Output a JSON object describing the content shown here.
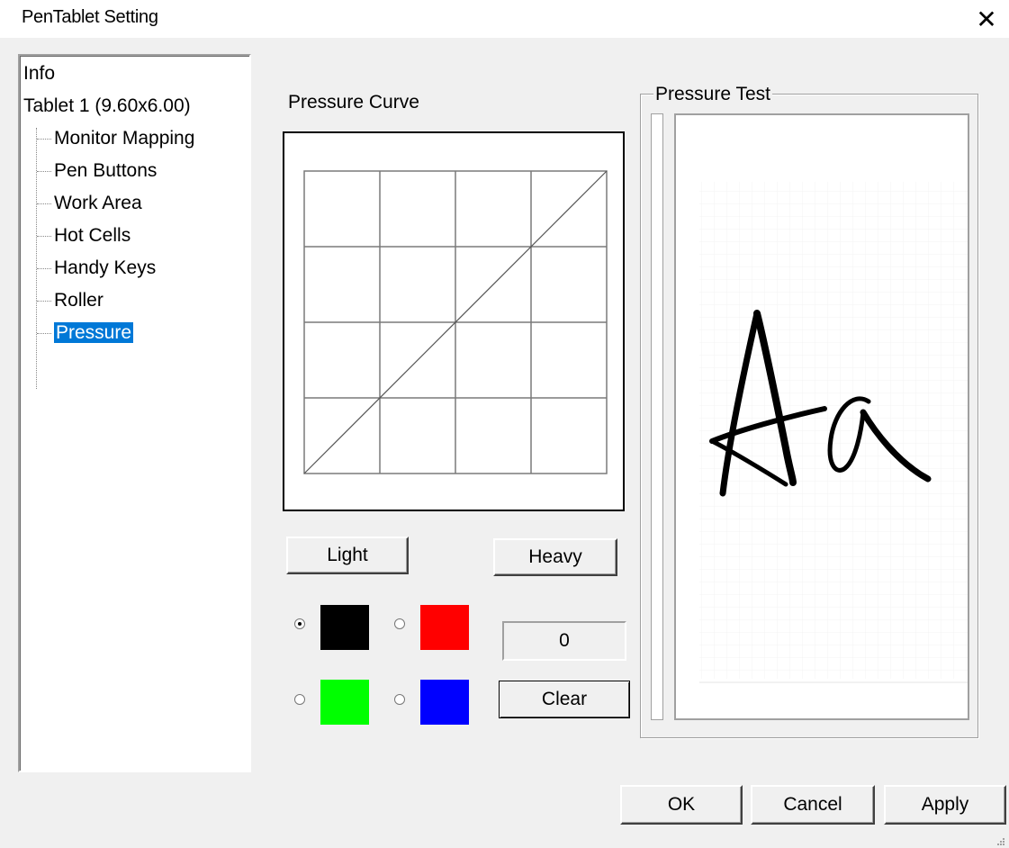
{
  "window": {
    "title": "PenTablet Setting",
    "close_symbol": "✕"
  },
  "tree": {
    "items": [
      {
        "label": "Info"
      },
      {
        "label": "Tablet  1 (9.60x6.00)"
      }
    ],
    "children": [
      {
        "label": "Monitor Mapping"
      },
      {
        "label": "Pen Buttons"
      },
      {
        "label": "Work Area"
      },
      {
        "label": "Hot Cells"
      },
      {
        "label": "Handy Keys"
      },
      {
        "label": "Roller"
      },
      {
        "label": "Pressure",
        "selected": true
      }
    ]
  },
  "pressure_curve": {
    "label": "Pressure Curve",
    "grid_divisions": 4,
    "curve": "linear",
    "light_label": "Light",
    "heavy_label": "Heavy"
  },
  "colors": {
    "options": [
      {
        "color": "#000000",
        "selected": true
      },
      {
        "color": "#ff0000",
        "selected": false
      },
      {
        "color": "#00ff00",
        "selected": false
      },
      {
        "color": "#0000ff",
        "selected": false
      }
    ]
  },
  "pressure_value": "0",
  "clear_label": "Clear",
  "pressure_test": {
    "label": "Pressure Test",
    "sample_text": "Aa"
  },
  "footer": {
    "ok_label": "OK",
    "cancel_label": "Cancel",
    "apply_label": "Apply"
  },
  "accent": "#0078d7"
}
